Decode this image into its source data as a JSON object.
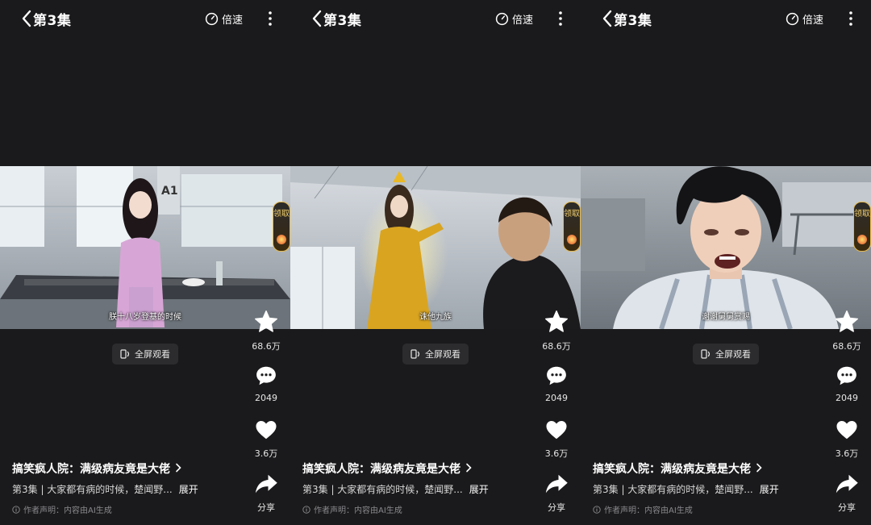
{
  "screens": [
    {
      "episode_title": "第3集",
      "speed_label": "倍速",
      "subtitle": "朕十八岁登基的时候",
      "reward_label": "领取",
      "fullscreen_label": "全屏观看",
      "favorite_count": "68.6万",
      "comment_count": "2049",
      "like_count": "3.6万",
      "share_label": "分享",
      "drama_title": "搞笑疯人院：满级病友竟是大佬",
      "description": "第3集 | 大家都有病的时候，楚闻野...",
      "expand_label": "展开",
      "disclaimer": "作者声明：内容由AI生成"
    },
    {
      "episode_title": "第3集",
      "speed_label": "倍速",
      "subtitle": "诛他九族",
      "reward_label": "领取",
      "fullscreen_label": "全屏观看",
      "favorite_count": "68.6万",
      "comment_count": "2049",
      "like_count": "3.6万",
      "share_label": "分享",
      "drama_title": "搞笑疯人院：满级病友竟是大佬",
      "description": "第3集 | 大家都有病的时候，楚闻野...",
      "expand_label": "展开",
      "disclaimer": "作者声明：内容由AI生成"
    },
    {
      "episode_title": "第3集",
      "speed_label": "倍速",
      "subtitle": "谢谢舅舅赏赐",
      "reward_label": "领取",
      "fullscreen_label": "全屏观看",
      "favorite_count": "68.6万",
      "comment_count": "2049",
      "like_count": "3.6万",
      "share_label": "分享",
      "drama_title": "搞笑疯人院：满级病友竟是大佬",
      "description": "第3集 | 大家都有病的时候，楚闻野...",
      "expand_label": "展开",
      "disclaimer": "作者声明：内容由AI生成"
    }
  ],
  "colors": {
    "background": "#1a1a1c",
    "text": "#ffffff",
    "muted": "#8a8a8e",
    "reward_border": "#e6b94b"
  },
  "icons": [
    "back-arrow-icon",
    "speed-gauge-icon",
    "more-vertical-icon",
    "star-icon",
    "comment-icon",
    "heart-icon",
    "share-icon",
    "fullscreen-icon",
    "info-icon",
    "chevron-right-icon"
  ]
}
